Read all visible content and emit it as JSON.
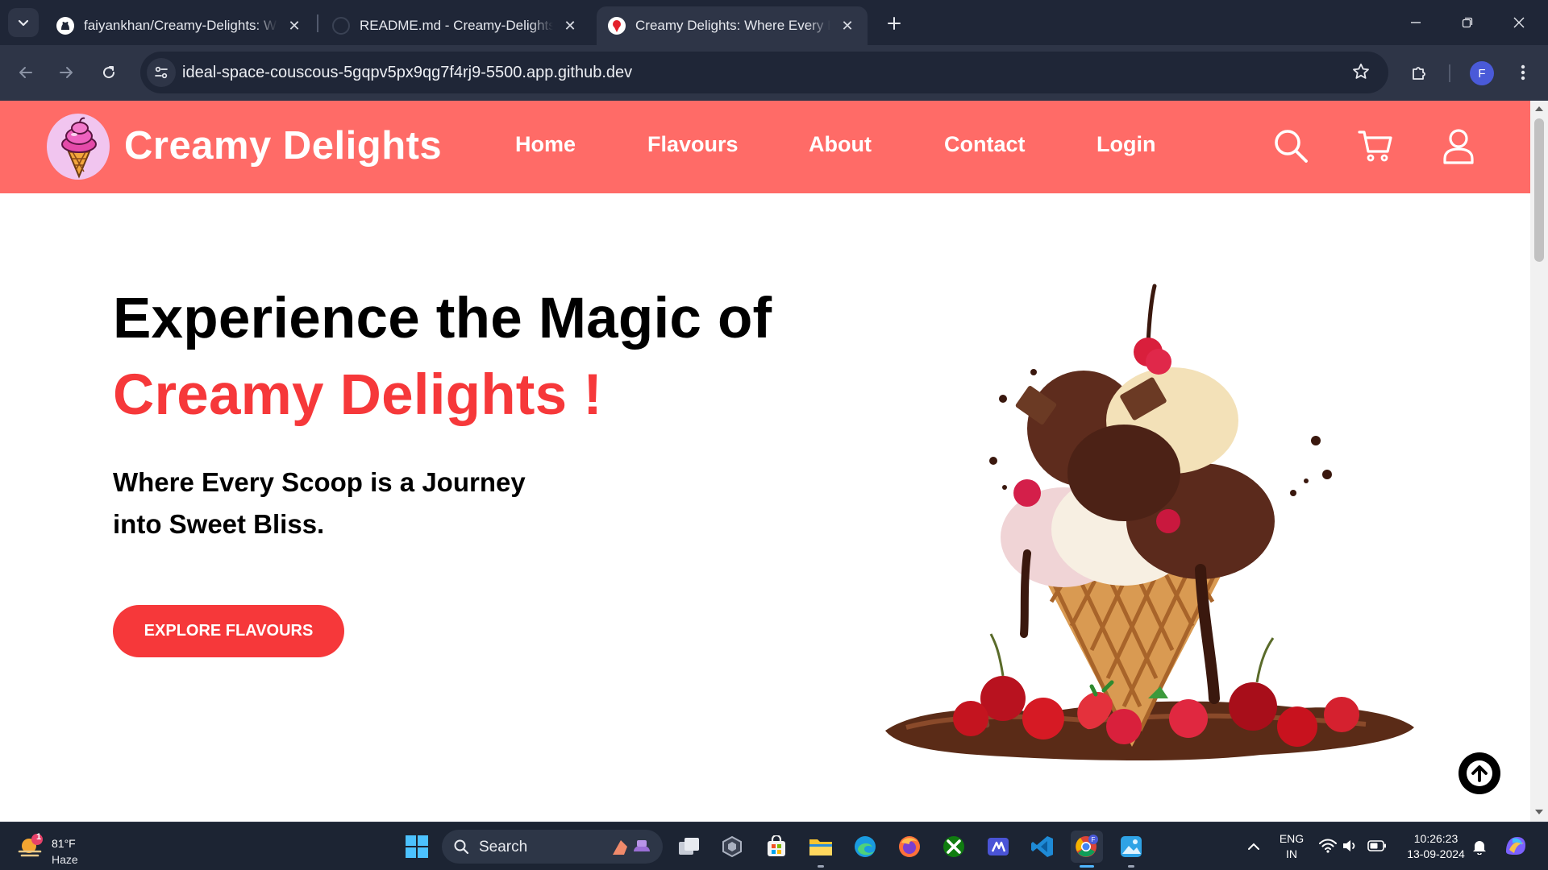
{
  "browser": {
    "tabs": [
      {
        "title": "faiyankhan/Creamy-Delights: Welc",
        "active": false
      },
      {
        "title": "README.md - Creamy-Delights [C",
        "active": false
      },
      {
        "title": "Creamy Delights: Where Every Bite",
        "active": true
      }
    ],
    "url": "ideal-space-couscous-5gqpv5px9qg7f4rj9-5500.app.github.dev",
    "profile_initial": "F"
  },
  "site": {
    "brand": "Creamy Delights",
    "nav": [
      "Home",
      "Flavours",
      "About",
      "Contact",
      "Login"
    ],
    "icons": [
      "search-icon",
      "cart-icon",
      "user-icon"
    ],
    "colors": {
      "header": "#ff6b67",
      "accent": "#f6383a"
    }
  },
  "hero": {
    "title_line1": "Experience the Magic of",
    "title_line2": "Creamy Delights !",
    "subtitle": "Where Every Scoop is a Journey into Sweet Bliss.",
    "cta": "EXPLORE FLAVOURS"
  },
  "taskbar": {
    "weather_temp": "81°F",
    "weather_cond": "Haze",
    "weather_badge": "1",
    "search_label": "Search",
    "lang_line1": "ENG",
    "lang_line2": "IN",
    "time": "10:26:23",
    "date": "13-09-2024"
  }
}
